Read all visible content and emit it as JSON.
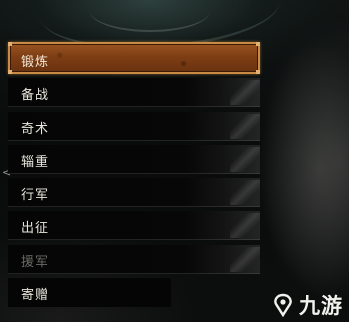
{
  "menu": {
    "items": [
      {
        "label": "锻炼",
        "state": "selected"
      },
      {
        "label": "备战",
        "state": "normal"
      },
      {
        "label": "奇术",
        "state": "normal"
      },
      {
        "label": "辎重",
        "state": "normal"
      },
      {
        "label": "行军",
        "state": "normal"
      },
      {
        "label": "出征",
        "state": "normal"
      },
      {
        "label": "援军",
        "state": "disabled"
      },
      {
        "label": "寄赠",
        "state": "normal"
      }
    ]
  },
  "side_mark": "<",
  "watermark": {
    "text": "九游",
    "icon": "jiuyou-logo-icon"
  },
  "colors": {
    "selected_fill": "#7d3e14",
    "selected_border": "#c88a45",
    "text": "#e8e6dc",
    "disabled_text": "#6a6a66"
  }
}
